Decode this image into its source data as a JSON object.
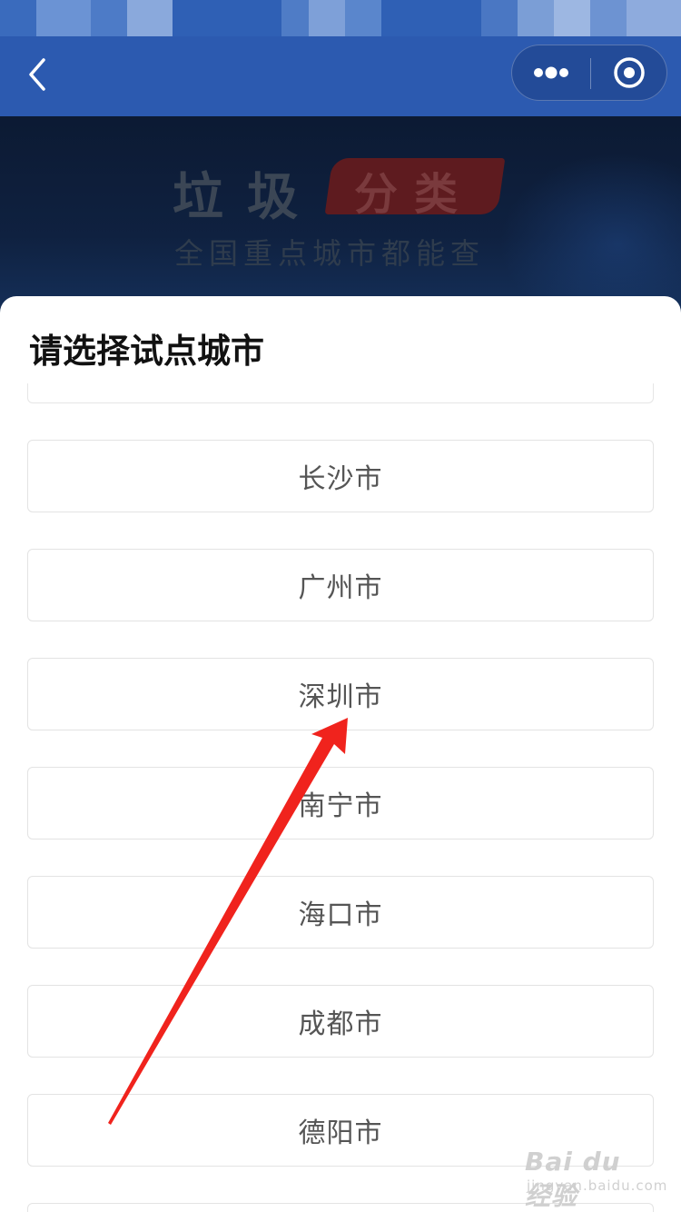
{
  "header": {
    "back_icon": "chevron-left-icon",
    "more_icon": "more-dots-icon",
    "close_icon": "target-close-icon"
  },
  "banner": {
    "title_part1": "垃圾",
    "title_part2": "分类",
    "subtitle": "全国重点城市都能查"
  },
  "sheet": {
    "title": "请选择试点城市",
    "cities": [
      {
        "label": "长沙市"
      },
      {
        "label": "广州市"
      },
      {
        "label": "深圳市"
      },
      {
        "label": "南宁市"
      },
      {
        "label": "海口市"
      },
      {
        "label": "成都市"
      },
      {
        "label": "德阳市"
      }
    ]
  },
  "annotation": {
    "arrow_color": "#f0231d",
    "arrow_target": "深圳市"
  },
  "watermark": {
    "main": "Bai du 经验",
    "sub": "jingyan.baidu.com"
  },
  "colors": {
    "nav_blue": "#2c5ab0",
    "banner_dark": "#0f2140",
    "item_border": "#e3e3e3"
  }
}
